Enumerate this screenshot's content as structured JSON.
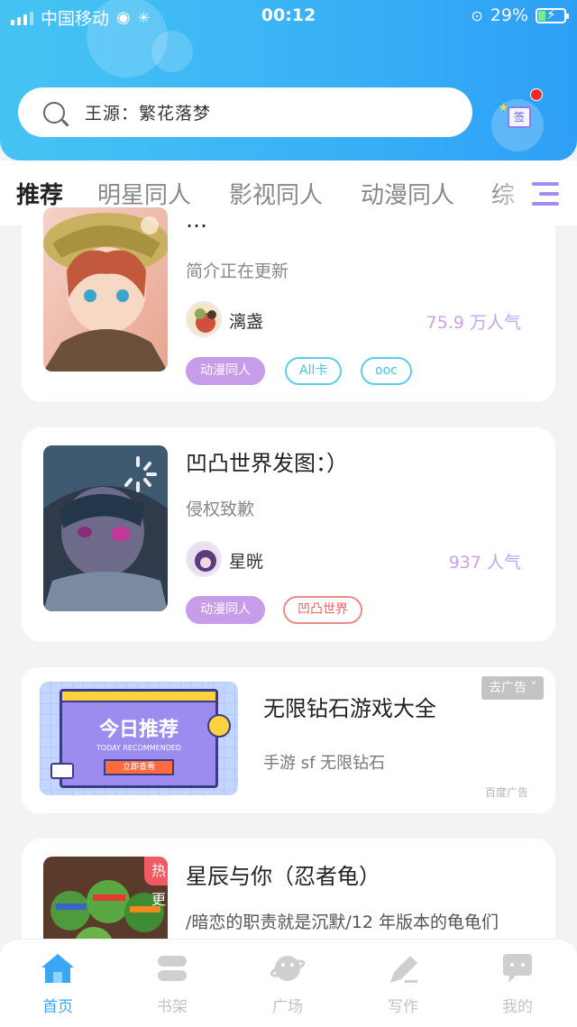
{
  "status_bar": {
    "carrier": "中国移动",
    "time": "00:12",
    "battery": "29%"
  },
  "search": {
    "placeholder": "王源：繁花落梦"
  },
  "checkin": {
    "label": "签"
  },
  "tabs": [
    {
      "label": "推荐",
      "active": true
    },
    {
      "label": "明星同人"
    },
    {
      "label": "影视同人"
    },
    {
      "label": "动漫同人"
    },
    {
      "label": "综"
    }
  ],
  "books": [
    {
      "title": "…",
      "description": "简介正在更新",
      "author": "漓盏",
      "popularity": "75.9 万人气",
      "tags": [
        "动漫同人",
        "All卡",
        "ooc"
      ]
    },
    {
      "title": "凹凸世界发图：）",
      "description": "侵权致歉",
      "author": "星晄",
      "popularity": "937 人气",
      "tags": [
        "动漫同人",
        "凹凸世界"
      ]
    }
  ],
  "ad": {
    "close_label": "去广告",
    "title": "无限钻石游戏大全",
    "description": "手游 sf 无限钻石",
    "source": "百度广告",
    "banner_title": "今日推荐",
    "banner_subtitle": "TODAY RECOMMENDED",
    "banner_button": "立即查看"
  },
  "featured": {
    "badge": "热更",
    "title": "星辰与你（忍者龟）",
    "description": "/暗恋的职责就是沉默/12 年版本的龟龟们"
  },
  "bottom_nav": [
    {
      "label": "首页",
      "icon": "home-icon",
      "active": true
    },
    {
      "label": "书架",
      "icon": "bookshelf-icon"
    },
    {
      "label": "广场",
      "icon": "planet-icon"
    },
    {
      "label": "写作",
      "icon": "pen-icon"
    },
    {
      "label": "我的",
      "icon": "chat-icon"
    }
  ],
  "colors": {
    "header_blue": "#38b0f6",
    "accent_purple": "#a68bf3",
    "nav_active": "#3aa7f5",
    "popularity": "#c8a3ee"
  }
}
